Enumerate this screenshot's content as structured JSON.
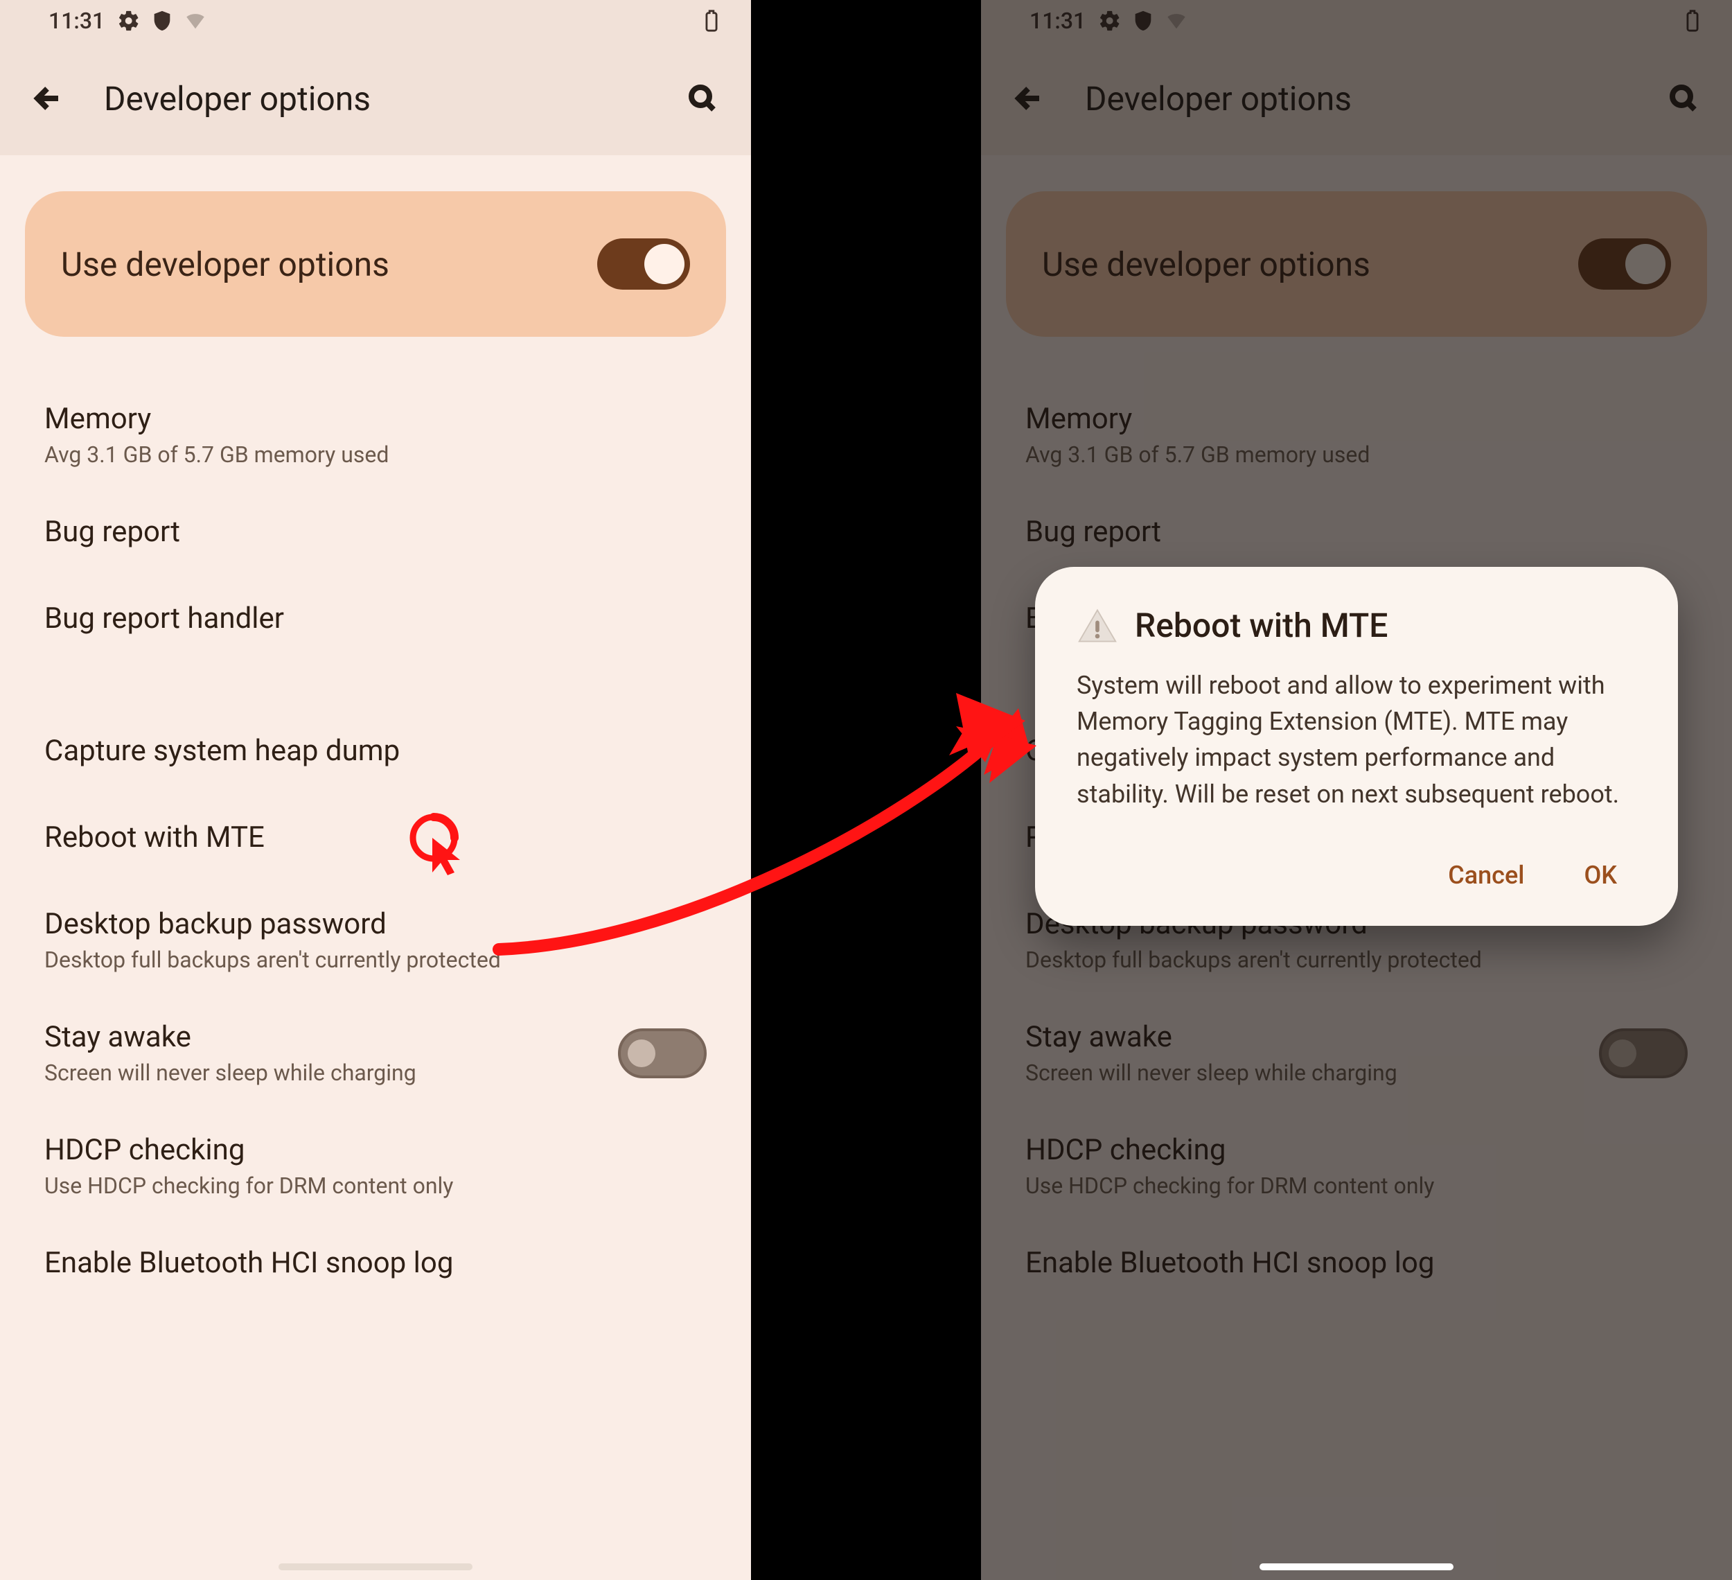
{
  "status": {
    "time": "11:31"
  },
  "appbar": {
    "title": "Developer options"
  },
  "hero": {
    "label": "Use developer options"
  },
  "rows": {
    "memory": {
      "title": "Memory",
      "sub": "Avg 3.1 GB of 5.7 GB memory used"
    },
    "bugreport": {
      "title": "Bug report"
    },
    "bughandler": {
      "title": "Bug report handler"
    },
    "heapdump": {
      "title": "Capture system heap dump"
    },
    "mte": {
      "title": "Reboot with MTE"
    },
    "desktopbk": {
      "title": "Desktop backup password",
      "sub": "Desktop full backups aren't currently protected"
    },
    "stayawake": {
      "title": "Stay awake",
      "sub": "Screen will never sleep while charging"
    },
    "hdcp": {
      "title": "HDCP checking",
      "sub": "Use HDCP checking for DRM content only"
    },
    "btsnoop": {
      "title": "Enable Bluetooth HCI snoop log"
    }
  },
  "dialog": {
    "title": "Reboot with MTE",
    "body": "System will reboot and allow to experiment with Memory Tagging Extension (MTE). MTE may negatively impact system performance and stability. Will be reset on next subsequent reboot.",
    "cancel": "Cancel",
    "ok": "OK"
  }
}
